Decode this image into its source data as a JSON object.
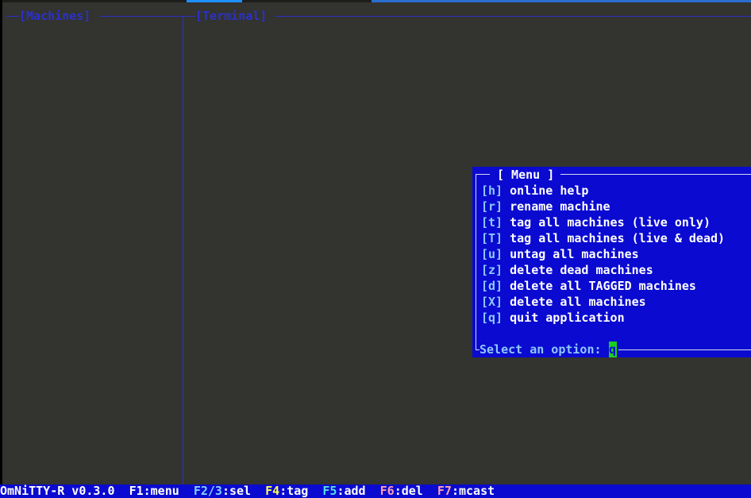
{
  "panes": {
    "machines_title": "[Machines]",
    "terminal_title": "[Terminal]"
  },
  "menu": {
    "title": "[ Menu ]",
    "items": [
      {
        "key": "[h]",
        "label": "online help"
      },
      {
        "key": "[r]",
        "label": "rename machine"
      },
      {
        "key": "[t]",
        "label": "tag all machines (live only)"
      },
      {
        "key": "[T]",
        "label": "tag all machines (live & dead)"
      },
      {
        "key": "[u]",
        "label": "untag all machines"
      },
      {
        "key": "[z]",
        "label": "delete dead machines"
      },
      {
        "key": "[d]",
        "label": "delete all TAGGED machines"
      },
      {
        "key": "[X]",
        "label": "delete all machines"
      },
      {
        "key": "[q]",
        "label": "quit application"
      }
    ],
    "prompt": "Select an option: ",
    "input_value": "q"
  },
  "statusbar": {
    "app_version": "OmNiTTY-R v0.3.0",
    "keys": [
      {
        "fkey": "F1",
        "label": ":menu"
      },
      {
        "fkey": "F2/3",
        "label": ":sel"
      },
      {
        "fkey": "F4",
        "label": ":tag"
      },
      {
        "fkey": "F5",
        "label": ":add"
      },
      {
        "fkey": "F6",
        "label": ":del"
      },
      {
        "fkey": "F7",
        "label": ":mcast"
      }
    ]
  },
  "colors": {
    "background": "#333330",
    "border": "#2b31c8",
    "menu_bg": "#0a0ad0",
    "accent_key": "#8fc8ff",
    "cursor": "#19d01c",
    "f1": "#ffffff",
    "f23": "#7fd0ff",
    "f4": "#ffff55",
    "f5": "#55e0e0",
    "f6": "#ff9fb0",
    "f7": "#ff9fb0"
  }
}
